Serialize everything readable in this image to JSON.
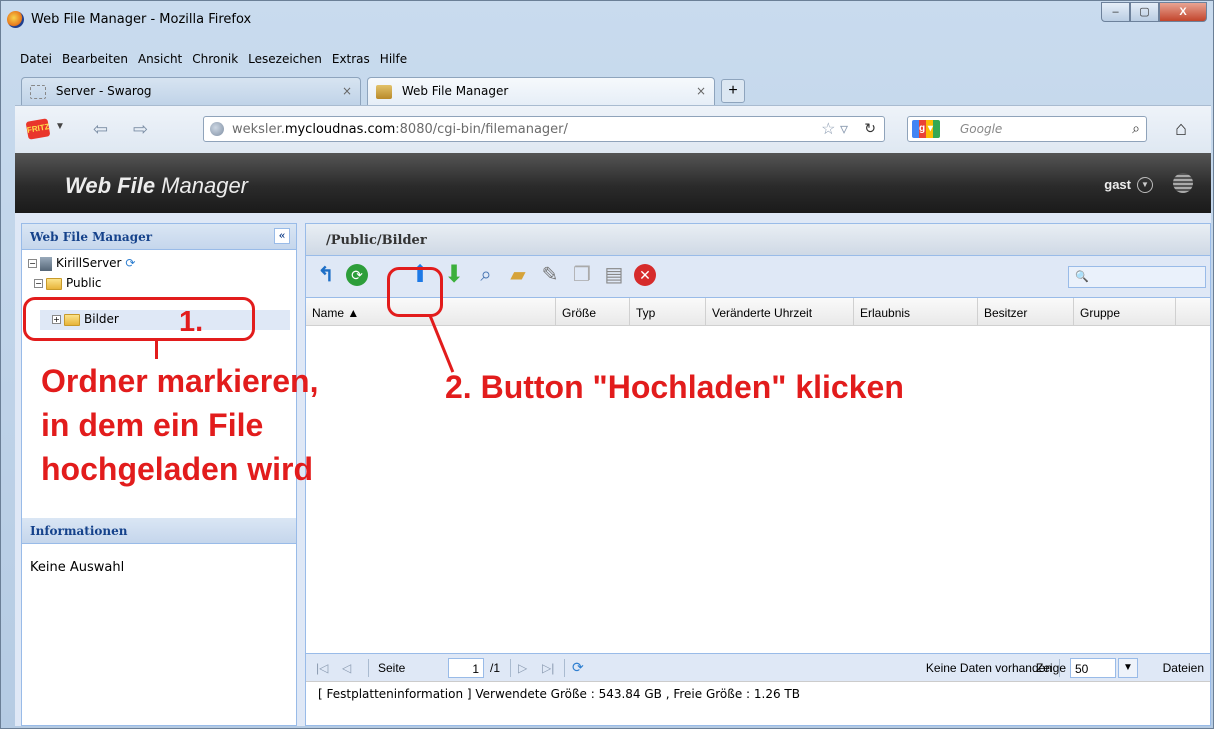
{
  "window": {
    "title": "Web File Manager - Mozilla Firefox",
    "controls": {
      "minimize": "‒",
      "maximize": "▢",
      "close": "X"
    }
  },
  "menu": [
    "Datei",
    "Bearbeiten",
    "Ansicht",
    "Chronik",
    "Lesezeichen",
    "Extras",
    "Hilfe"
  ],
  "tabs": [
    {
      "label": "Server - Swarog",
      "close": "×"
    },
    {
      "label": "Web File Manager",
      "close": "×"
    }
  ],
  "new_tab": "+",
  "address_bar": {
    "url_host_prefix": "weksler.",
    "url_host_main": "mycloudnas.com",
    "url_rest": ":8080/cgi-bin/filemanager/"
  },
  "search_bar": {
    "placeholder": "Google"
  },
  "app": {
    "title_bold": "Web File",
    "title_rest": " Manager",
    "user": "gast"
  },
  "left_panel": {
    "header": "Web File Manager",
    "tree": [
      {
        "label": "KirillServer"
      },
      {
        "label": "Public"
      },
      {
        "label": "Bilder"
      }
    ],
    "info_header": "Informationen",
    "info_text": "Keine Auswahl"
  },
  "right_panel": {
    "path": "/Public/Bilder",
    "filter_icon": "🔍",
    "columns": [
      "Name ▲",
      "Größe",
      "Typ",
      "Veränderte Uhrzeit",
      "Erlaubnis",
      "Besitzer",
      "Gruppe"
    ]
  },
  "pager": {
    "page_label": "Seite",
    "page_value": "1",
    "page_total": "/1",
    "status": "Keine Daten vorhanden",
    "show_label": "Zeige",
    "page_size": "50",
    "unit": "Dateien"
  },
  "footer": "[ Festplatteninformation ] Verwendete Größe : 543.84 GB , Freie Größe : 1.26 TB",
  "annotations": {
    "step1_number": "1.",
    "step1_line1": "Ordner markieren,",
    "step1_line2": "in dem ein File",
    "step1_line3": "hochgeladen wird",
    "step2": "2. Button \"Hochladen\" klicken"
  },
  "colors": {
    "annotation": "#e21c1c",
    "panel_border": "#99bbe8",
    "panel_title": "#15428b"
  }
}
